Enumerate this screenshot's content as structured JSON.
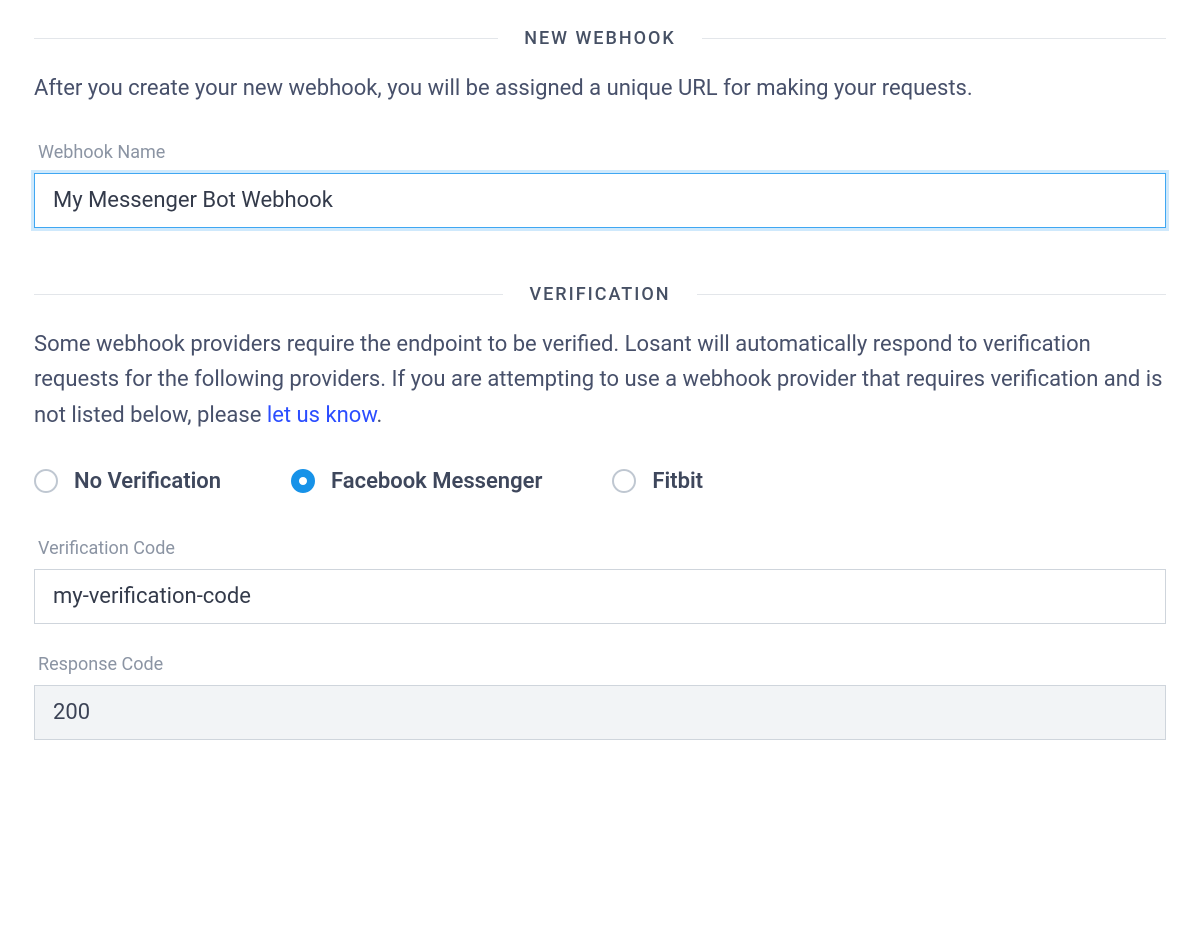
{
  "new_webhook": {
    "heading": "NEW WEBHOOK",
    "description": "After you create your new webhook, you will be assigned a unique URL for making your requests.",
    "name_label": "Webhook Name",
    "name_value": "My Messenger Bot Webhook"
  },
  "verification": {
    "heading": "VERIFICATION",
    "description_pre": "Some webhook providers require the endpoint to be verified. Losant will automatically respond to verification requests for the following providers. If you are attempting to use a webhook provider that requires verification and is not listed below, please ",
    "link_text": "let us know",
    "description_post": ".",
    "options": {
      "none": "No Verification",
      "facebook": "Facebook Messenger",
      "fitbit": "Fitbit"
    },
    "selected": "facebook",
    "code_label": "Verification Code",
    "code_value": "my-verification-code",
    "response_label": "Response Code",
    "response_value": "200"
  }
}
